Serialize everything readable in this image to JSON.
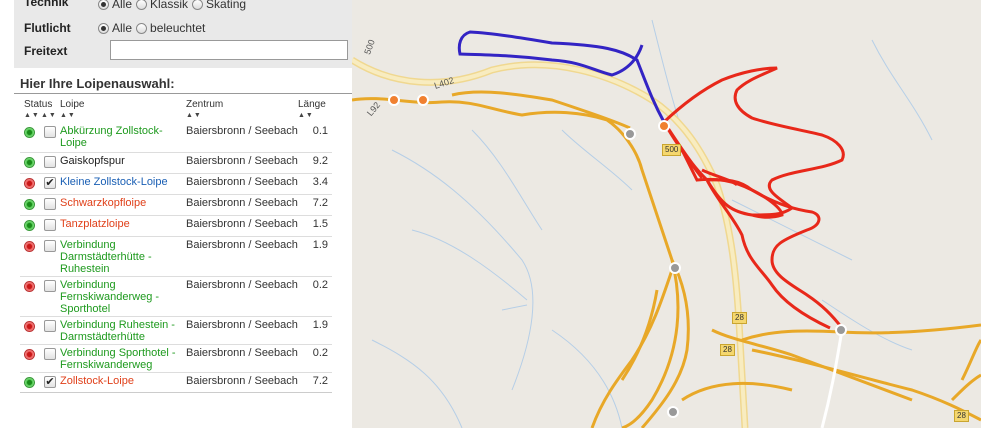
{
  "filters": {
    "technik": {
      "label": "Technik",
      "options": [
        {
          "label": "Alle",
          "selected": true
        },
        {
          "label": "Klassik",
          "selected": false
        },
        {
          "label": "Skating",
          "selected": false
        }
      ]
    },
    "flutlicht": {
      "label": "Flutlicht",
      "options": [
        {
          "label": "Alle",
          "selected": true
        },
        {
          "label": "beleuchtet",
          "selected": false
        }
      ]
    },
    "freitext": {
      "label": "Freitext",
      "value": ""
    }
  },
  "selection": {
    "title": "Hier Ihre Loipenauswahl:",
    "columns": {
      "status": "Status",
      "loipe": "Loipe",
      "zentrum": "Zentrum",
      "laenge": "Länge"
    },
    "sort_arrows": "▲▼",
    "rows": [
      {
        "name": "Abkürzung Zollstock-Loipe",
        "zentrum": "Baiersbronn / Seebach",
        "laenge": "0.1",
        "status": "open",
        "checked": false,
        "color": "#1e9a1e"
      },
      {
        "name": "Gaiskopfspur",
        "zentrum": "Baiersbronn / Seebach",
        "laenge": "9.2",
        "status": "open",
        "checked": false,
        "color": "#222222"
      },
      {
        "name": "Kleine Zollstock-Loipe",
        "zentrum": "Baiersbronn / Seebach",
        "laenge": "3.4",
        "status": "closed",
        "checked": true,
        "color": "#1a5fb4"
      },
      {
        "name": "Schwarzkopfloipe",
        "zentrum": "Baiersbronn / Seebach",
        "laenge": "7.2",
        "status": "open",
        "checked": false,
        "color": "#e0401a"
      },
      {
        "name": "Tanzplatzloipe",
        "zentrum": "Baiersbronn / Seebach",
        "laenge": "1.5",
        "status": "open",
        "checked": false,
        "color": "#e0401a"
      },
      {
        "name": "Verbindung Darmstädterhütte - Ruhestein",
        "zentrum": "Baiersbronn / Seebach",
        "laenge": "1.9",
        "status": "closed",
        "checked": false,
        "color": "#1e9a1e"
      },
      {
        "name": "Verbindung Fernskiwanderweg - Sporthotel",
        "zentrum": "Baiersbronn / Seebach",
        "laenge": "0.2",
        "status": "closed",
        "checked": false,
        "color": "#1e9a1e"
      },
      {
        "name": "Verbindung Ruhestein - Darmstädterhütte",
        "zentrum": "Baiersbronn / Seebach",
        "laenge": "1.9",
        "status": "closed",
        "checked": false,
        "color": "#1e9a1e"
      },
      {
        "name": "Verbindung Sporthotel - Fernskiwanderweg",
        "zentrum": "Baiersbronn / Seebach",
        "laenge": "0.2",
        "status": "closed",
        "checked": false,
        "color": "#1e9a1e"
      },
      {
        "name": "Zollstock-Loipe",
        "zentrum": "Baiersbronn / Seebach",
        "laenge": "7.2",
        "status": "open",
        "checked": true,
        "color": "#e0401a"
      }
    ]
  },
  "map": {
    "road_labels": [
      "L402",
      "L92",
      "500",
      "500",
      "28",
      "28"
    ],
    "route_colors": {
      "blue": "#3324c4",
      "red": "#e8281a",
      "road": "#e8a828"
    }
  }
}
